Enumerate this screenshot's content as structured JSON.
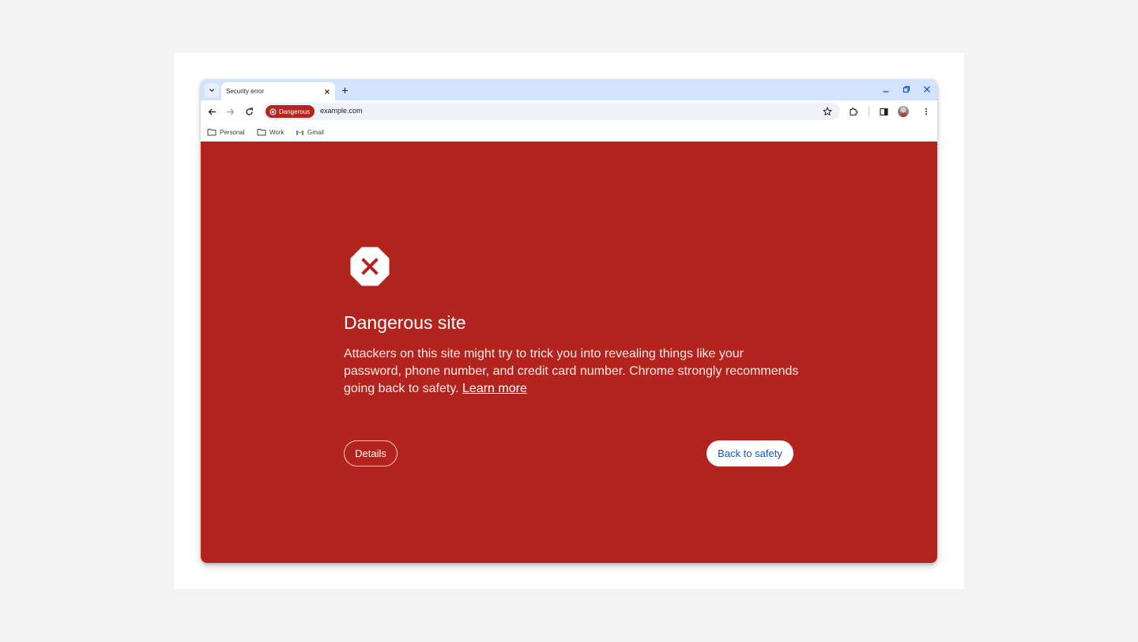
{
  "tab": {
    "title": "Security error"
  },
  "toolbar": {
    "security_chip_label": "Dangerous",
    "url": "example.com"
  },
  "bookmarks": [
    {
      "label": "Personal",
      "icon": "folder-icon"
    },
    {
      "label": "Work",
      "icon": "folder-icon"
    },
    {
      "label": "Gmail",
      "icon": "gmail-icon"
    }
  ],
  "interstitial": {
    "icon": "danger-octagon-icon",
    "heading": "Dangerous site",
    "body": "Attackers on this site might try to trick you into revealing things like your password, phone number, and credit card number. Chrome strongly recommends going back to safety.",
    "learn_more": "Learn more",
    "details_button": "Details",
    "back_button": "Back to safety"
  },
  "colors": {
    "danger_background": "#b3241f",
    "tabstrip": "#d3e3fd",
    "accent_blue": "#0b57d0",
    "danger_chip": "#b3261e"
  }
}
